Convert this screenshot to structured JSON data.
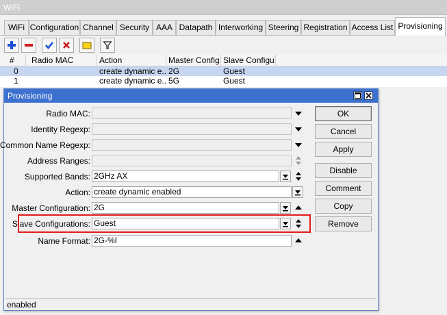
{
  "window": {
    "title": "WiFi"
  },
  "tabs": [
    {
      "label": "WiFi"
    },
    {
      "label": "Configuration"
    },
    {
      "label": "Channel"
    },
    {
      "label": "Security"
    },
    {
      "label": "AAA"
    },
    {
      "label": "Datapath"
    },
    {
      "label": "Interworking"
    },
    {
      "label": "Steering"
    },
    {
      "label": "Registration"
    },
    {
      "label": "Access List"
    },
    {
      "label": "Provisioning"
    }
  ],
  "active_tab": "Provisioning",
  "toolbar": {
    "icons": [
      "plus-icon",
      "minus-icon",
      "check-icon",
      "x-icon",
      "note-icon",
      "filter-icon"
    ],
    "colors": {
      "plus": "#1c4fd6",
      "minus": "#d21c1c",
      "check": "#1c4fd6",
      "x": "#d21c1c",
      "note": "#f7d21a"
    }
  },
  "table": {
    "columns": [
      "#",
      "Radio MAC",
      "Action",
      "Master Config...",
      "Slave Configu..."
    ],
    "rows": [
      {
        "num": "0",
        "radio_mac": "",
        "action": "create dynamic e...",
        "master": "2G",
        "slave": "Guest"
      },
      {
        "num": "1",
        "radio_mac": "",
        "action": "create dynamic e...",
        "master": "5G",
        "slave": "Guest"
      }
    ]
  },
  "dialog": {
    "title": "Provisioning",
    "fields": {
      "radio_mac": {
        "label": "Radio MAC:",
        "value": ""
      },
      "identity_regexp": {
        "label": "Identity Regexp:",
        "value": ""
      },
      "common_name_regexp": {
        "label": "Common Name Regexp:",
        "value": ""
      },
      "address_ranges": {
        "label": "Address Ranges:",
        "value": ""
      },
      "supported_bands": {
        "label": "Supported Bands:",
        "value": "2GHz AX"
      },
      "action": {
        "label": "Action:",
        "value": "create dynamic enabled"
      },
      "master_configuration": {
        "label": "Master Configuration:",
        "value": "2G"
      },
      "slave_configurations": {
        "label": "Slave Configurations:",
        "value": "Guest"
      },
      "name_format": {
        "label": "Name Format:",
        "value": "2G-%I"
      }
    },
    "buttons": {
      "ok": "OK",
      "cancel": "Cancel",
      "apply": "Apply",
      "disable": "Disable",
      "comment": "Comment",
      "copy": "Copy",
      "remove": "Remove"
    },
    "status": "enabled",
    "highlight_color": "#e21b1b"
  }
}
